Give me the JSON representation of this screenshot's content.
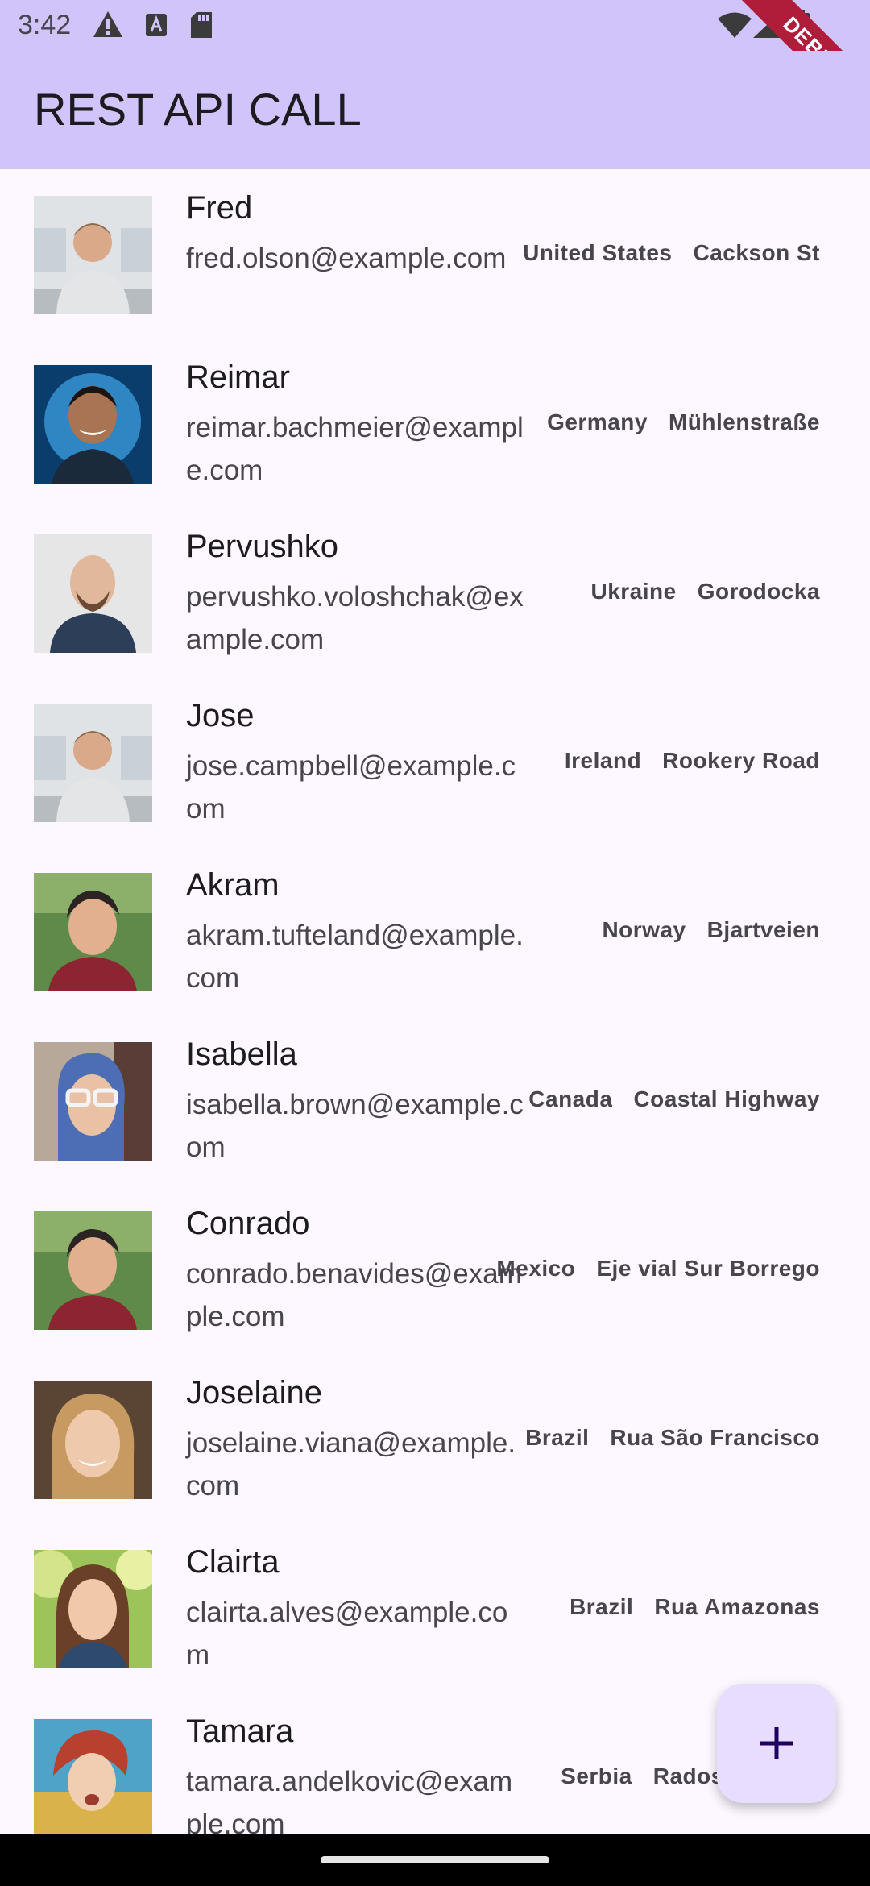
{
  "status": {
    "time": "3:42"
  },
  "debug_label": "DEBUG",
  "app_title": "REST API CALL",
  "users": [
    {
      "name": "Fred",
      "email": "fred.olson@example.com",
      "country": "United States",
      "street": "Cackson St"
    },
    {
      "name": "Reimar",
      "email": "reimar.bachmeier@example.com",
      "country": "Germany",
      "street": "Mühlenstraße"
    },
    {
      "name": "Pervushko",
      "email": "pervushko.voloshchak@example.com",
      "country": "Ukraine",
      "street": "Gorodocka"
    },
    {
      "name": "Jose",
      "email": "jose.campbell@example.com",
      "country": "Ireland",
      "street": "Rookery Road"
    },
    {
      "name": "Akram",
      "email": "akram.tufteland@example.com",
      "country": "Norway",
      "street": "Bjartveien"
    },
    {
      "name": "Isabella",
      "email": "isabella.brown@example.com",
      "country": "Canada",
      "street": "Coastal Highway"
    },
    {
      "name": "Conrado",
      "email": "conrado.benavides@example.com",
      "country": "Mexico",
      "street": "Eje vial Sur Borrego"
    },
    {
      "name": "Joselaine",
      "email": "joselaine.viana@example.com",
      "country": "Brazil",
      "street": "Rua São Francisco"
    },
    {
      "name": "Clairta",
      "email": "clairta.alves@example.com",
      "country": "Brazil",
      "street": "Rua Amazonas"
    },
    {
      "name": "Tamara",
      "email": "tamara.andelkovic@example.com",
      "country": "Serbia",
      "street": "Radoslava Rad"
    }
  ],
  "fab_icon": "plus-icon"
}
